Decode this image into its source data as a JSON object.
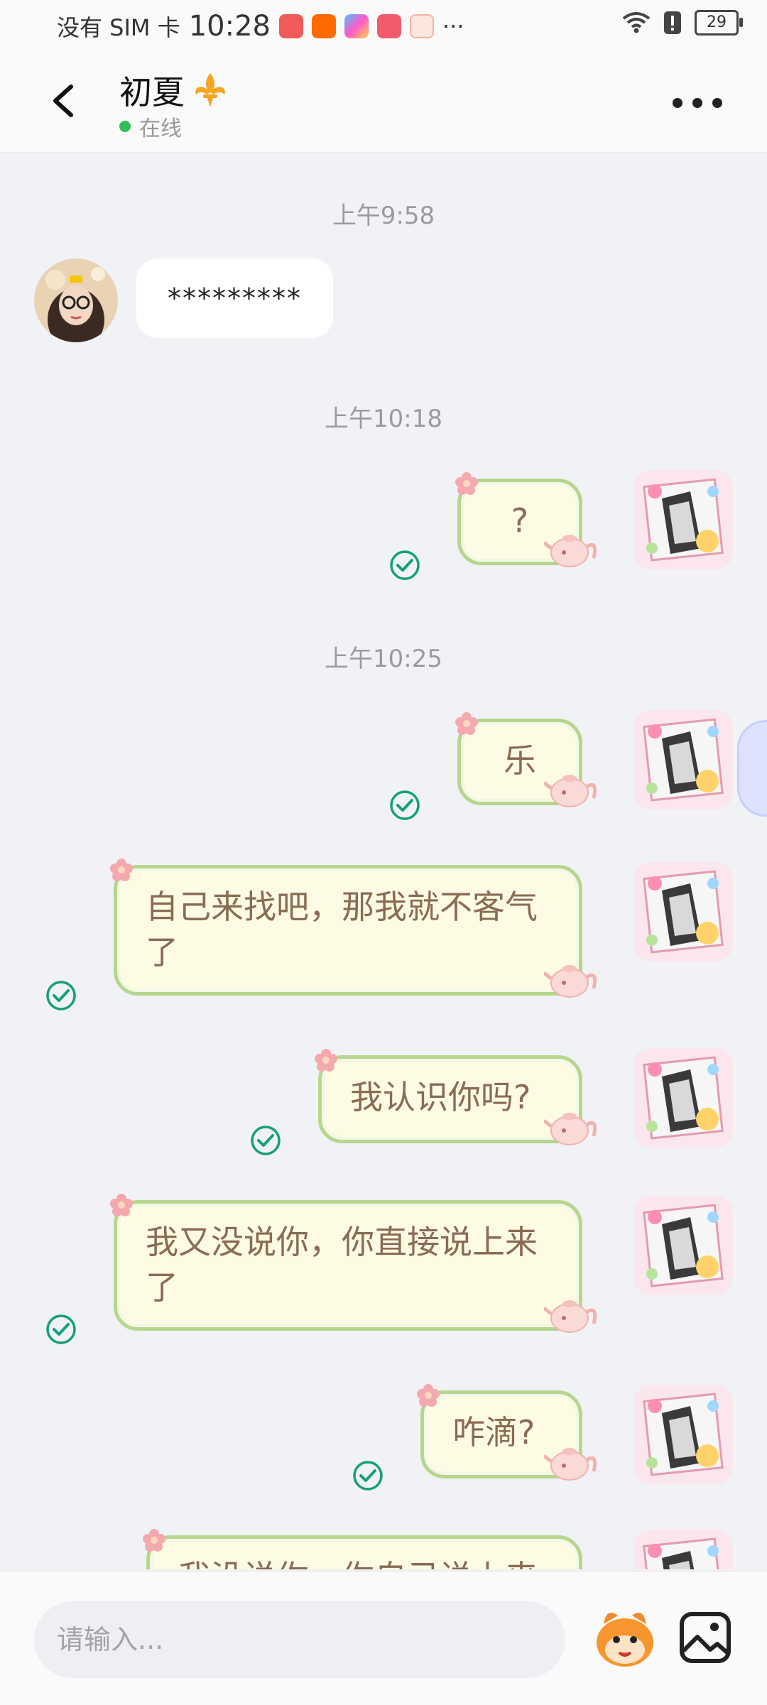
{
  "status_bar": {
    "carrier": "没有 SIM 卡",
    "time": "10:28",
    "more": "···",
    "battery": "29"
  },
  "header": {
    "contact_name": "初夏",
    "online_status": "在线"
  },
  "messages": [
    {
      "type": "time",
      "text": "上午9:58"
    },
    {
      "type": "in",
      "text": "*********"
    },
    {
      "type": "time",
      "text": "上午10:18"
    },
    {
      "type": "out",
      "text": "?"
    },
    {
      "type": "time",
      "text": "上午10:25"
    },
    {
      "type": "out",
      "text": "乐"
    },
    {
      "type": "out",
      "text": "自己来找吧，那我就不客气了"
    },
    {
      "type": "out",
      "text": "我认识你吗?"
    },
    {
      "type": "out",
      "text": "我又没说你，你直接说上来了"
    },
    {
      "type": "out",
      "text": "咋滴?"
    },
    {
      "type": "out",
      "text": "我没说你，你自己说上来"
    }
  ],
  "input": {
    "placeholder": "请输入..."
  },
  "colors": {
    "bubble_fill": "#fdfbe3",
    "bubble_border": "#b6d68d",
    "bubble_text": "#8a6b54",
    "read_check": "#13a07a",
    "online_dot": "#2ec15b"
  }
}
